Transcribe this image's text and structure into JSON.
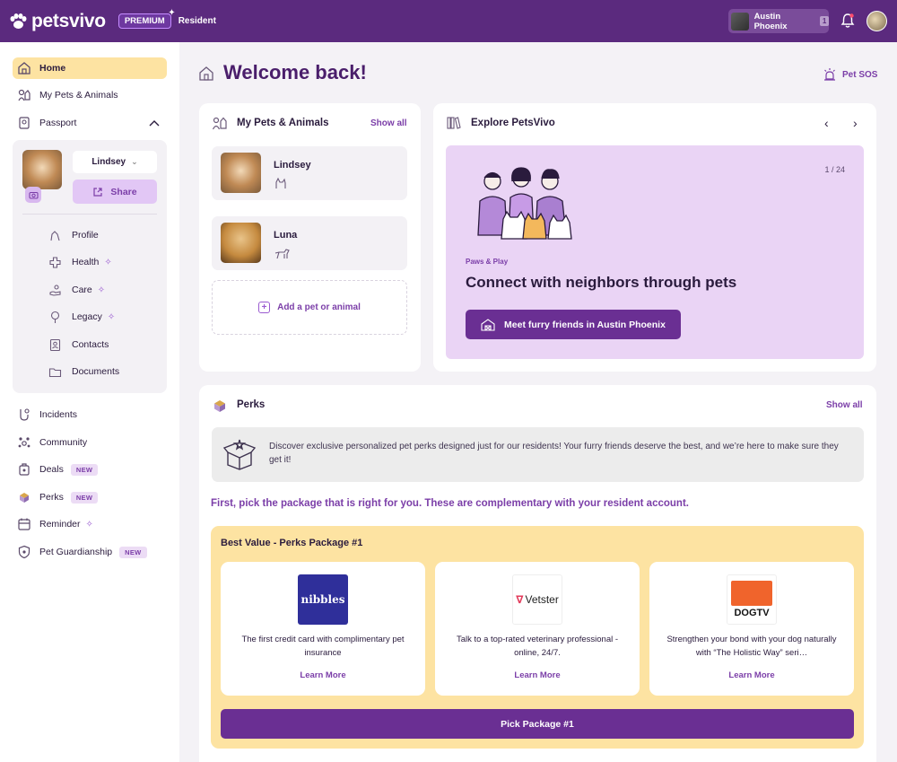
{
  "brand": {
    "name": "petsvivo",
    "premium_label": "PREMIUM",
    "resident_label": "Resident"
  },
  "topbar": {
    "user_name": "Austin Phoenix",
    "user_count": "1"
  },
  "sidebar": {
    "items": [
      {
        "label": "Home",
        "icon": "house-icon"
      },
      {
        "label": "My Pets & Animals",
        "icon": "pets-icon"
      },
      {
        "label": "Passport",
        "icon": "passport-icon"
      },
      {
        "label": "Incidents",
        "icon": "incident-icon"
      },
      {
        "label": "Community",
        "icon": "community-icon"
      },
      {
        "label": "Deals",
        "badge": "NEW",
        "icon": "deals-icon"
      },
      {
        "label": "Perks",
        "badge": "NEW",
        "icon": "perks-icon"
      },
      {
        "label": "Reminder",
        "icon": "reminder-icon"
      },
      {
        "label": "Pet Guardianship",
        "badge": "NEW",
        "icon": "guardianship-icon"
      }
    ],
    "passport": {
      "selected_pet": "Lindsey",
      "share_label": "Share",
      "subitems": [
        {
          "label": "Profile"
        },
        {
          "label": "Health"
        },
        {
          "label": "Care"
        },
        {
          "label": "Legacy"
        },
        {
          "label": "Contacts"
        },
        {
          "label": "Documents"
        }
      ]
    }
  },
  "main": {
    "title": "Welcome back!",
    "pet_sos": "Pet SOS",
    "pets_card": {
      "title": "My Pets & Animals",
      "show_all": "Show all",
      "pets": [
        {
          "name": "Lindsey"
        },
        {
          "name": "Luna"
        }
      ],
      "add_label": "Add a pet or animal"
    },
    "explore": {
      "title": "Explore PetsVivo",
      "counter": "1 / 24",
      "tag": "Paws & Play",
      "heading": "Connect with neighbors through pets",
      "button": "Meet furry friends in Austin Phoenix"
    },
    "perks": {
      "title": "Perks",
      "show_all": "Show all",
      "info": "Discover exclusive personalized pet perks designed just for our residents! Your furry friends deserve the best, and we’re here to make sure they get it!",
      "intro": "First, pick the package that is right for you. These are complementary with your resident account.",
      "package_title": "Best Value - Perks Package #1",
      "cards": [
        {
          "logo_text": "nibbles",
          "desc": "The first credit card with complimentary pet insurance",
          "link": "Learn More"
        },
        {
          "logo_text": "Vetster",
          "desc": "Talk to a top-rated veterinary professional - online, 24/7.",
          "link": "Learn More"
        },
        {
          "logo_text": "DOGTV",
          "desc": "Strengthen your bond with your dog naturally with “The Holistic Way” seri…",
          "link": "Learn More"
        }
      ],
      "pick_button": "Pick Package #1"
    }
  },
  "colors": {
    "brand_purple": "#5b2a7e",
    "accent_purple": "#7b3ea8",
    "highlight_yellow": "#fde3a2",
    "lavender": "#ead4f5"
  }
}
